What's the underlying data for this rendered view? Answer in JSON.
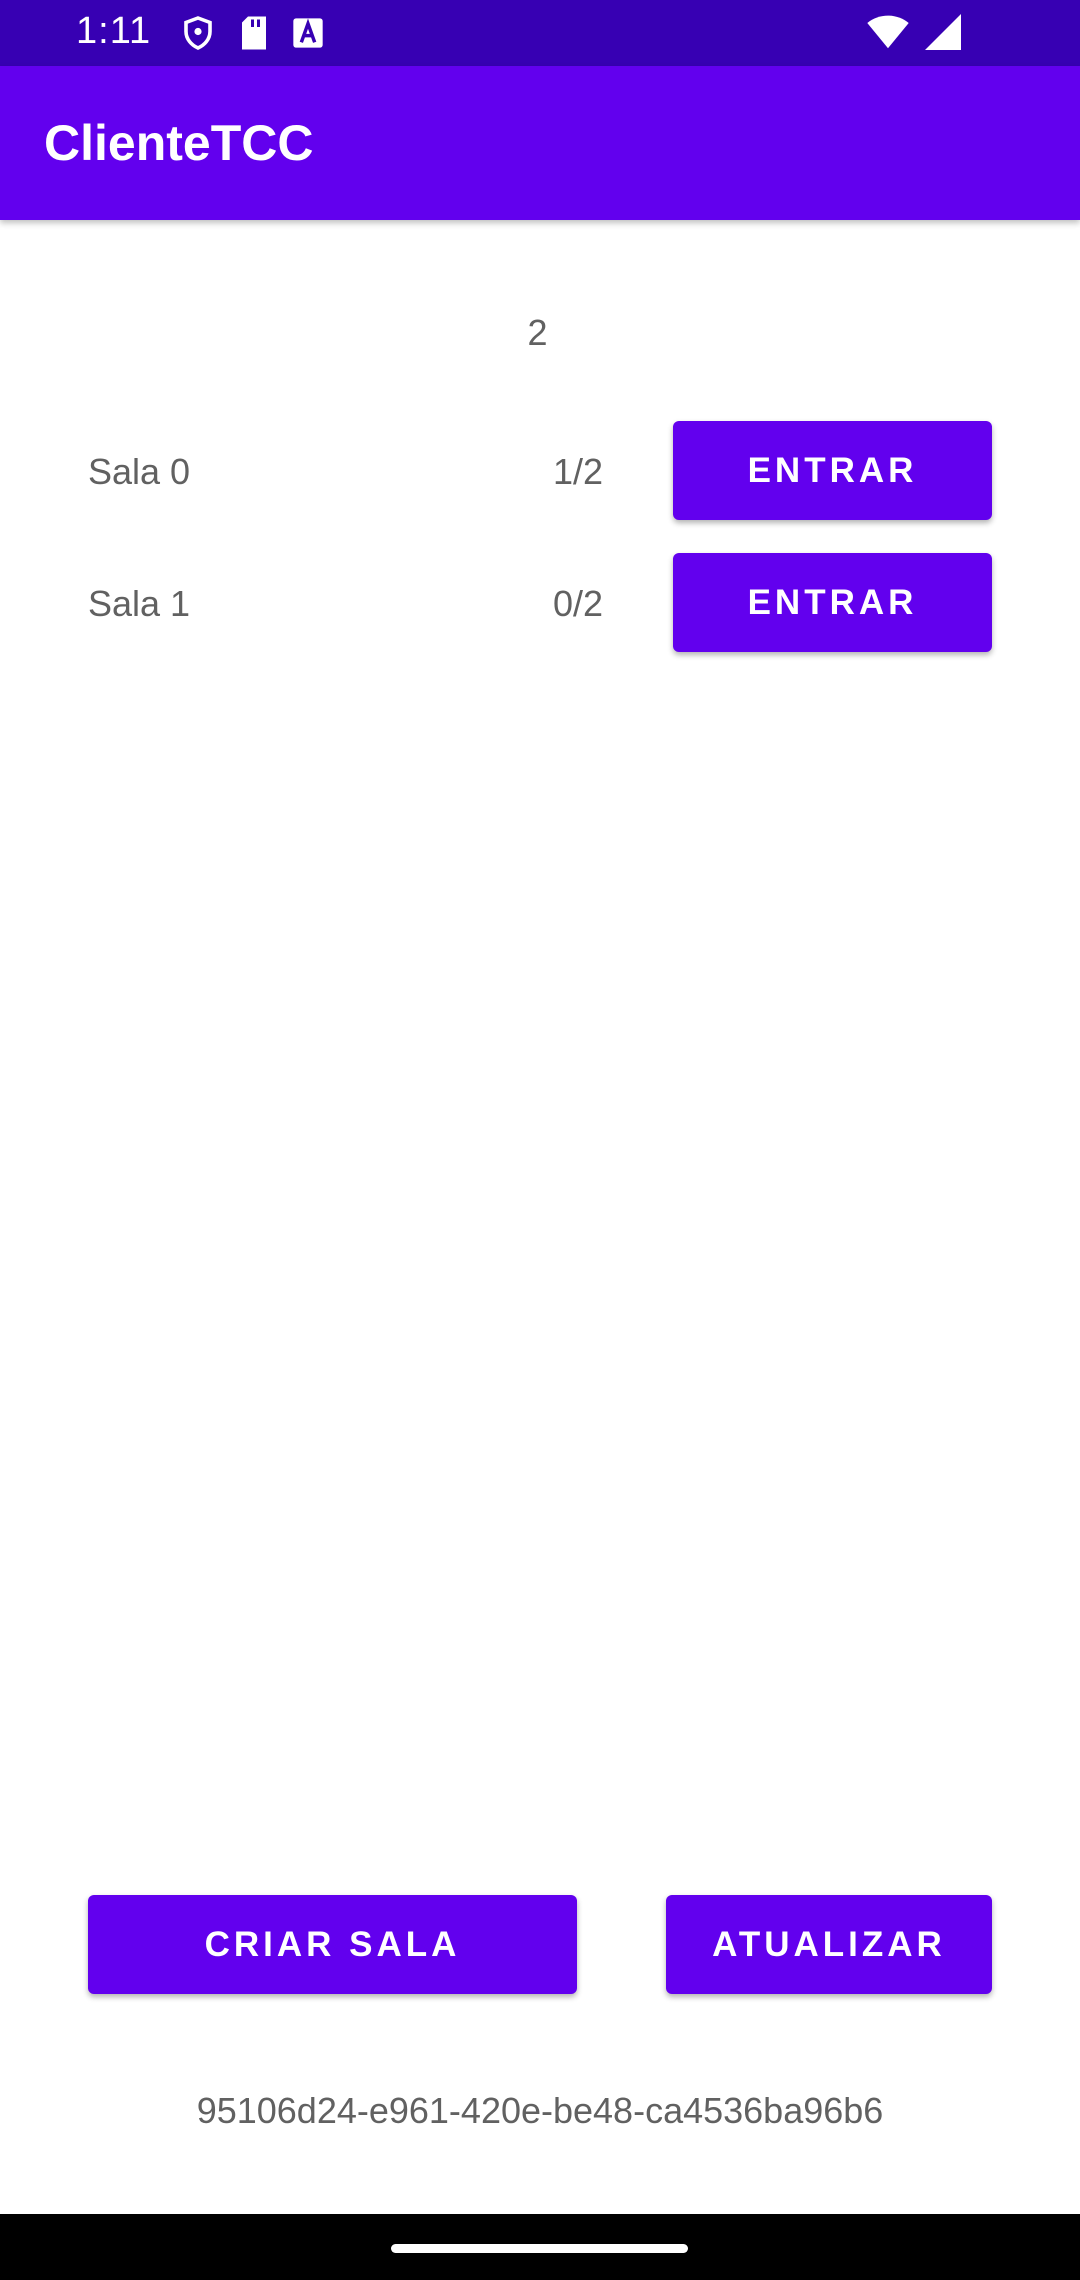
{
  "status_bar": {
    "time": "1:11",
    "icons": [
      "shield-icon",
      "sd-card-icon",
      "font-a-icon",
      "wifi-icon",
      "signal-icon"
    ]
  },
  "app_bar": {
    "title": "ClienteTCC"
  },
  "room_count": "2",
  "rooms": [
    {
      "name": "Sala 0",
      "occupancy": "1/2",
      "button_label": "ENTRAR"
    },
    {
      "name": "Sala 1",
      "occupancy": "0/2",
      "button_label": "ENTRAR"
    }
  ],
  "actions": {
    "create_label": "CRIAR SALA",
    "update_label": "ATUALIZAR"
  },
  "client_id": "95106d24-e961-420e-be48-ca4536ba96b6",
  "colors": {
    "status_bar": "#3700b3",
    "primary": "#6200ee",
    "text_secondary": "#616161",
    "nav_bar": "#000000"
  }
}
